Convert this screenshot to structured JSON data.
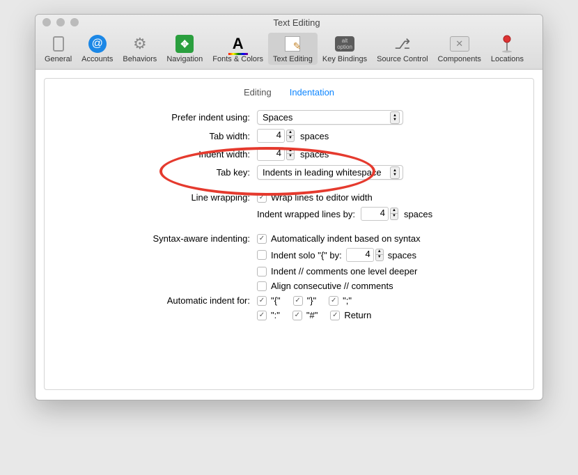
{
  "window": {
    "title": "Text Editing"
  },
  "toolbar": {
    "items": [
      {
        "label": "General"
      },
      {
        "label": "Accounts"
      },
      {
        "label": "Behaviors"
      },
      {
        "label": "Navigation"
      },
      {
        "label": "Fonts & Colors"
      },
      {
        "label": "Text Editing"
      },
      {
        "label": "Key Bindings"
      },
      {
        "label": "Source Control"
      },
      {
        "label": "Components"
      },
      {
        "label": "Locations"
      }
    ]
  },
  "tabs": {
    "editing": "Editing",
    "indentation": "Indentation"
  },
  "form": {
    "preferIndent": {
      "label": "Prefer indent using:",
      "value": "Spaces"
    },
    "tabWidth": {
      "label": "Tab width:",
      "value": "4",
      "unit": "spaces"
    },
    "indentWidth": {
      "label": "Indent width:",
      "value": "4",
      "unit": "spaces"
    },
    "tabKey": {
      "label": "Tab key:",
      "value": "Indents in leading whitespace"
    },
    "lineWrap": {
      "label": "Line wrapping:",
      "wrap": "Wrap lines to editor width",
      "indentWrapped": "Indent wrapped lines by:",
      "value": "4",
      "unit": "spaces"
    },
    "syntax": {
      "label": "Syntax-aware indenting:",
      "auto": "Automatically indent based on syntax",
      "soloBrace": "Indent solo \"{\" by:",
      "soloValue": "4",
      "soloUnit": "spaces",
      "commentsDeeper": "Indent // comments one level deeper",
      "alignComments": "Align consecutive // comments"
    },
    "autoIndentFor": {
      "label": "Automatic indent for:",
      "row1": [
        "\"{\"",
        "\"}\"",
        "\";\""
      ],
      "row2": [
        "\":\"",
        "\"#\"",
        "Return"
      ]
    }
  }
}
